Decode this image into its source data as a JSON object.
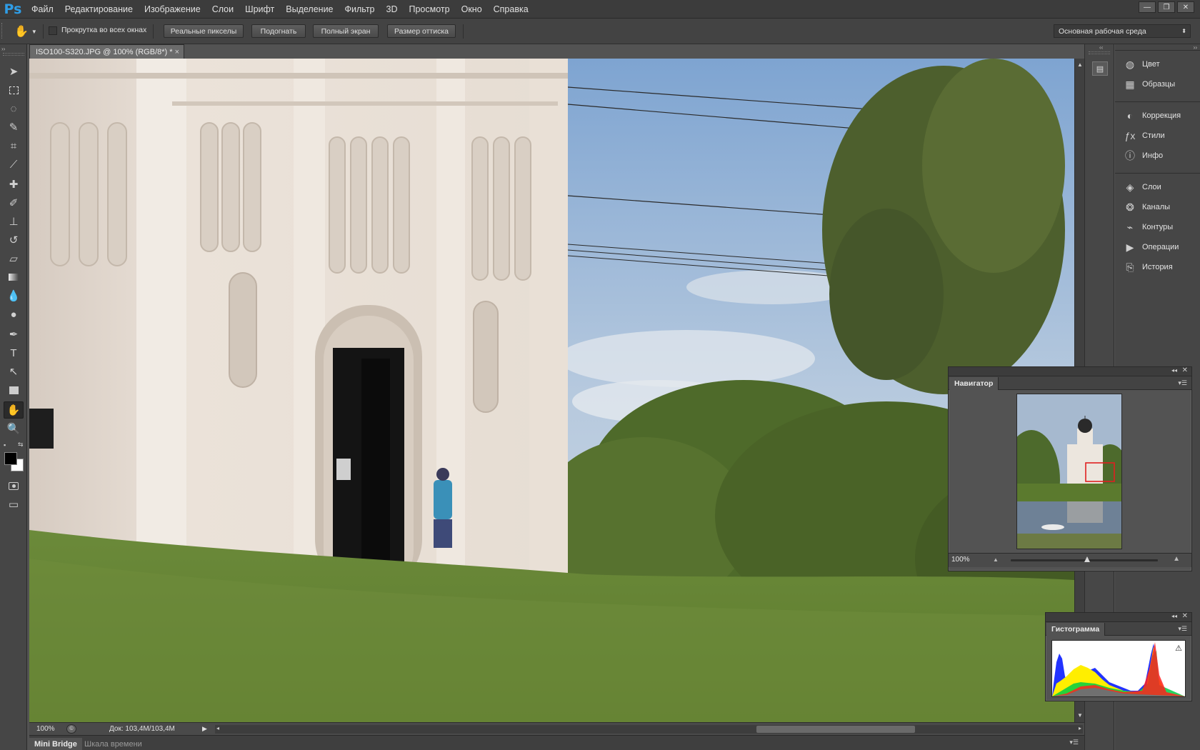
{
  "app": {
    "logo": "Ps"
  },
  "menu": [
    "Файл",
    "Редактирование",
    "Изображение",
    "Слои",
    "Шрифт",
    "Выделение",
    "Фильтр",
    "3D",
    "Просмотр",
    "Окно",
    "Справка"
  ],
  "window_controls": [
    "—",
    "❐",
    "✕"
  ],
  "options_bar": {
    "scroll_all_label": "Прокрутка во всех окнах",
    "scroll_all_checked": false,
    "buttons": [
      "Реальные пикселы",
      "Подогнать",
      "Полный экран",
      "Размер оттиска"
    ],
    "workspace": "Основная рабочая среда"
  },
  "document": {
    "tab_title": "ISO100-S320.JPG @ 100% (RGB/8*) *",
    "close": "×"
  },
  "status": {
    "zoom": "100%",
    "doc_info": "Док: 103,4M/103,4M"
  },
  "bottom_tabs": [
    "Mini Bridge",
    "Шкала времени"
  ],
  "dock": {
    "groups": [
      [
        {
          "label": "Цвет",
          "icon": "color-wheel-icon"
        },
        {
          "label": "Образцы",
          "icon": "swatches-grid-icon"
        }
      ],
      [
        {
          "label": "Коррекция",
          "icon": "adjustments-icon"
        },
        {
          "label": "Стили",
          "icon": "fx-styles-icon"
        },
        {
          "label": "Инфо",
          "icon": "info-icon"
        }
      ],
      [
        {
          "label": "Слои",
          "icon": "layers-icon"
        },
        {
          "label": "Каналы",
          "icon": "channels-icon"
        },
        {
          "label": "Контуры",
          "icon": "paths-icon"
        },
        {
          "label": "Операции",
          "icon": "play-actions-icon"
        },
        {
          "label": "История",
          "icon": "history-icon"
        }
      ]
    ]
  },
  "navigator": {
    "title": "Навигатор",
    "zoom": "100%",
    "zoom_slider": 0.52
  },
  "histogram": {
    "title": "Гистограмма",
    "warning": "!"
  },
  "colors": {
    "foreground": "#000000",
    "background": "#ffffff",
    "nav_view_box": "#e02020"
  }
}
